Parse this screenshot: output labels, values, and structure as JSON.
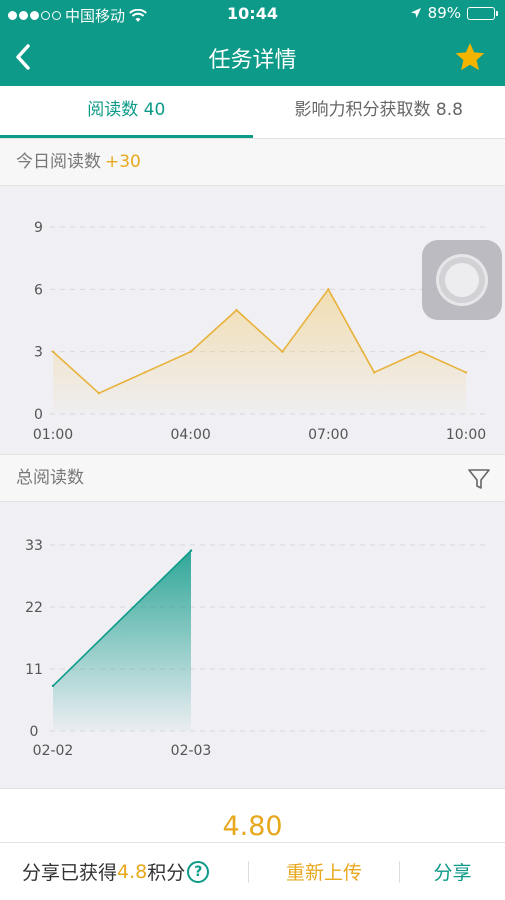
{
  "status_bar": {
    "carrier": "中国移动",
    "time": "10:44",
    "battery": "89%",
    "battery_level": 0.89
  },
  "nav": {
    "title": "任务详情",
    "back_icon": "chevron-left-icon",
    "favorite_icon": "star-icon",
    "favorite_color": "#f4b400"
  },
  "tabs": [
    {
      "label": "阅读数 40",
      "active": true
    },
    {
      "label": "影响力积分获取数 8.8",
      "active": false
    }
  ],
  "today_section": {
    "title": "今日阅读数",
    "delta": "+30"
  },
  "total_section": {
    "title": "总阅读数",
    "filter_icon": "filter-icon"
  },
  "colors": {
    "brand": "#0d9a88",
    "accent": "#e7a81d",
    "line_today": "#e8b23a"
  },
  "chart_data": [
    {
      "type": "line",
      "title": "今日阅读数",
      "x_ticks": [
        "01:00",
        "04:00",
        "07:00",
        "10:00"
      ],
      "y_ticks": [
        "0",
        "3",
        "6",
        "9"
      ],
      "ylim": [
        0,
        9
      ],
      "x": [
        1,
        2,
        3,
        4,
        5,
        6,
        7,
        8,
        9,
        10
      ],
      "values": [
        3,
        1,
        2,
        3,
        5,
        3,
        6,
        2,
        3,
        2
      ],
      "grid": true
    },
    {
      "type": "area",
      "title": "总阅读数",
      "x_ticks": [
        "02-02",
        "02-03"
      ],
      "y_ticks": [
        "0",
        "11",
        "22",
        "33"
      ],
      "ylim": [
        0,
        33
      ],
      "x": [
        "02-02",
        "02-03"
      ],
      "values": [
        8,
        32
      ],
      "grid": true
    }
  ],
  "reward": {
    "amount": "4.80",
    "earned_prefix": "分享已获得",
    "earned_points": "4.8",
    "earned_suffix": "积分",
    "help_glyph": "?",
    "help_icon": "question-circle-icon"
  },
  "actions": {
    "reupload": "重新上传",
    "share": "分享"
  },
  "assistive_touch_icon": "assistive-touch-icon"
}
